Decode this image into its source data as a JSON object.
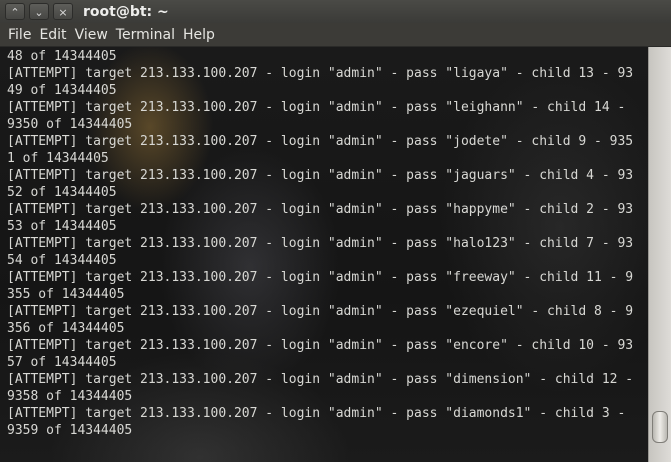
{
  "window": {
    "title": "root@bt: ~",
    "controls": {
      "up_glyph": "⌃",
      "down_glyph": "⌄",
      "close_glyph": "×"
    }
  },
  "menu": [
    "File",
    "Edit",
    "View",
    "Terminal",
    "Help"
  ],
  "terminal": {
    "lines": [
      "48 of 14344405",
      "[ATTEMPT] target 213.133.100.207 - login \"admin\" - pass \"ligaya\" - child 13 - 93",
      "49 of 14344405",
      "[ATTEMPT] target 213.133.100.207 - login \"admin\" - pass \"leighann\" - child 14 -",
      "9350 of 14344405",
      "[ATTEMPT] target 213.133.100.207 - login \"admin\" - pass \"jodete\" - child 9 - 935",
      "1 of 14344405",
      "[ATTEMPT] target 213.133.100.207 - login \"admin\" - pass \"jaguars\" - child 4 - 93",
      "52 of 14344405",
      "[ATTEMPT] target 213.133.100.207 - login \"admin\" - pass \"happyme\" - child 2 - 93",
      "53 of 14344405",
      "[ATTEMPT] target 213.133.100.207 - login \"admin\" - pass \"halo123\" - child 7 - 93",
      "54 of 14344405",
      "[ATTEMPT] target 213.133.100.207 - login \"admin\" - pass \"freeway\" - child 11 - 9",
      "355 of 14344405",
      "[ATTEMPT] target 213.133.100.207 - login \"admin\" - pass \"ezequiel\" - child 8 - 9",
      "356 of 14344405",
      "[ATTEMPT] target 213.133.100.207 - login \"admin\" - pass \"encore\" - child 10 - 93",
      "57 of 14344405",
      "[ATTEMPT] target 213.133.100.207 - login \"admin\" - pass \"dimension\" - child 12 -",
      "9358 of 14344405",
      "[ATTEMPT] target 213.133.100.207 - login \"admin\" - pass \"diamonds1\" - child 3 -",
      "9359 of 14344405"
    ],
    "scroll_position_fraction": 0.97
  },
  "colors": {
    "terminal_text": "#d8d8d4",
    "titlebar": "#3b3b38",
    "menubar": "#3c3b37"
  }
}
